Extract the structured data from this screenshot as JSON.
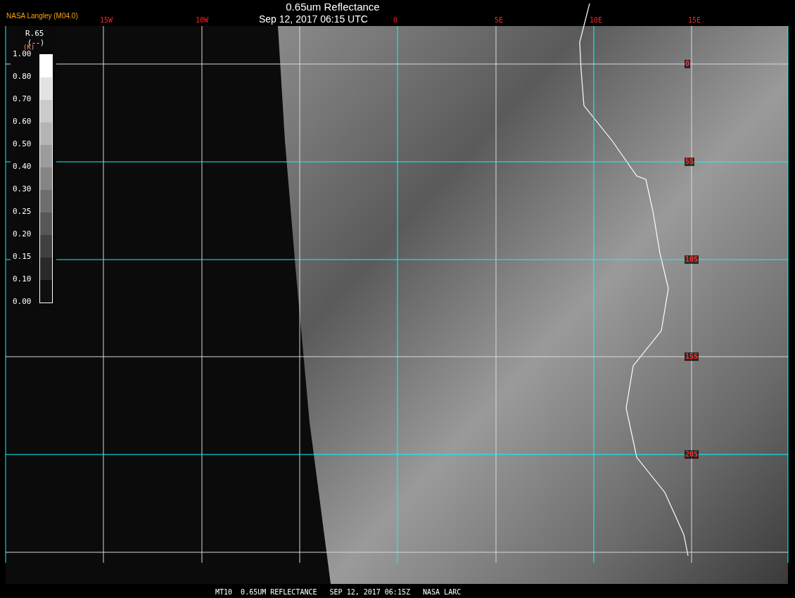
{
  "title": "0.65um Reflectance",
  "timestamp": "Sep 12, 2017 06:15 UTC",
  "credit": "NASA Langley (M04.0)",
  "longitude_labels": [
    "15W",
    "10W",
    "0",
    "5E",
    "10E",
    "15E"
  ],
  "latitude_labels": [
    "0",
    "5S",
    "10S",
    "15S",
    "20S"
  ],
  "legend": {
    "title": "R.65",
    "units": "(--)",
    "unit_mark": "(K)",
    "labels": [
      "1.00",
      "0.80",
      "0.70",
      "0.60",
      "0.50",
      "0.40",
      "0.30",
      "0.25",
      "0.20",
      "0.15",
      "0.10",
      "0.00"
    ],
    "steps": [
      {
        "color": "#ffffff"
      },
      {
        "color": "#e3e3e3"
      },
      {
        "color": "#cbcbcb"
      },
      {
        "color": "#b4b4b4"
      },
      {
        "color": "#9c9c9c"
      },
      {
        "color": "#858585"
      },
      {
        "color": "#6e6e6e"
      },
      {
        "color": "#575757"
      },
      {
        "color": "#404040"
      },
      {
        "color": "#292929"
      },
      {
        "color": "#0f0f0f"
      }
    ]
  },
  "footer": "MT10  0.65UM REFLECTANCE   SEP 12, 2017 06:15Z   NASA LARC"
}
